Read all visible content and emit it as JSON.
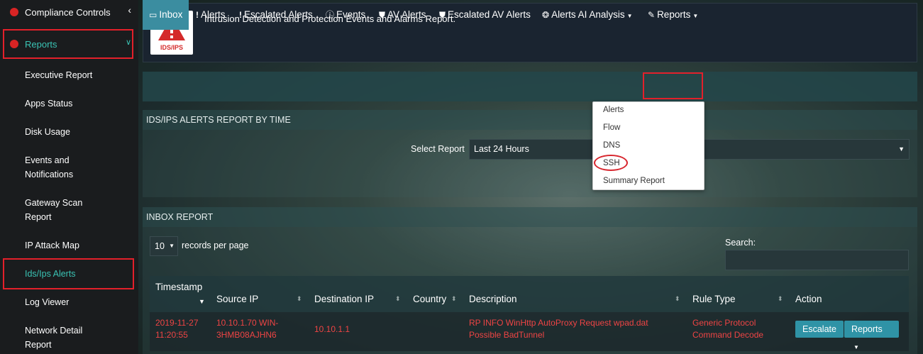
{
  "sidebar": {
    "compliance_label": "Compliance Controls",
    "reports_label": "Reports",
    "items": [
      {
        "label": "Executive Report"
      },
      {
        "label": "Apps Status"
      },
      {
        "label": "Disk Usage"
      },
      {
        "label": "Events and",
        "label2": "Notifications"
      },
      {
        "label": "Gateway Scan",
        "label2": "Report"
      },
      {
        "label": "IP Attack Map"
      },
      {
        "label": "Ids/Ips Alerts"
      },
      {
        "label": "Log Viewer"
      },
      {
        "label": "Network Detail",
        "label2": "Report"
      }
    ]
  },
  "header": {
    "logo_text": "IDS/IPS",
    "title": "Intrusion Detection and Protection Events and Alarms Report."
  },
  "tabs": [
    {
      "label": "Inbox",
      "icon": "inbox-icon"
    },
    {
      "label": "Alerts",
      "icon": "exclamation-icon"
    },
    {
      "label": "Escalated Alerts",
      "icon": "exclamation-icon"
    },
    {
      "label": "Events",
      "icon": "info-circle-icon"
    },
    {
      "label": "AV Alerts",
      "icon": "shield-icon"
    },
    {
      "label": "Escalated AV Alerts",
      "icon": "shield-icon"
    },
    {
      "label": "Alerts AI Analysis",
      "icon": "brain-icon"
    },
    {
      "label": "Reports",
      "icon": "pencil-icon"
    }
  ],
  "report_panel": {
    "title": "IDS/IPS ALERTS REPORT BY TIME",
    "select_label": "Select Report",
    "select_value": "Last 24 Hours"
  },
  "reports_menu": [
    "Alerts",
    "Flow",
    "DNS",
    "SSH",
    "Summary Report"
  ],
  "inbox": {
    "title": "INBOX REPORT",
    "page_length": "10",
    "length_label": "records per page",
    "search_label": "Search:",
    "columns": [
      "Timestamp",
      "Source IP",
      "Destination IP",
      "Country",
      "Description",
      "Rule Type",
      "Action"
    ],
    "rows": [
      {
        "timestamp_1": "2019-11-27",
        "timestamp_2": "11:20:55",
        "source_1": "10.10.1.70 WIN-",
        "source_2": "3HMB08AJHN6",
        "destination": "10.10.1.1",
        "country": "",
        "description_1": "RP INFO WinHttp AutoProxy Request wpad.dat",
        "description_2": "Possible BadTunnel",
        "rule_1": "Generic Protocol",
        "rule_2": "Command Decode",
        "escalate_label": "Escalate",
        "reports_label": "Reports"
      }
    ]
  },
  "colors": {
    "accent": "#3ac3b4",
    "active_tab": "#3b8da0",
    "alert_text": "#e44444",
    "highlight": "#e3202a"
  }
}
